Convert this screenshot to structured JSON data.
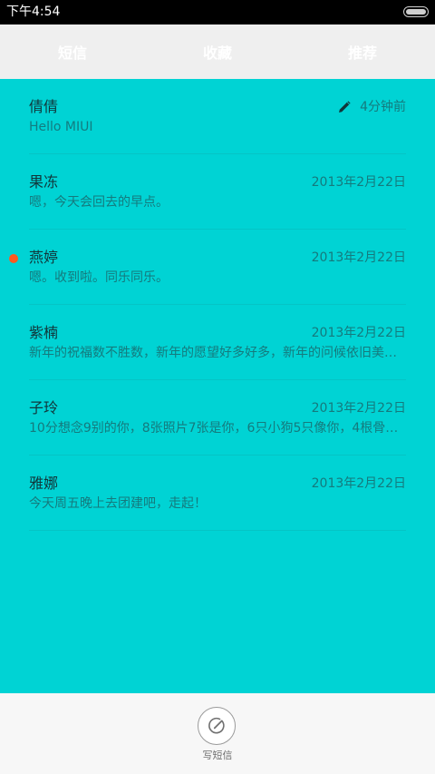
{
  "status_bar": {
    "time": "下午4:54"
  },
  "tabs": [
    {
      "label": "短信"
    },
    {
      "label": "收藏"
    },
    {
      "label": "推荐"
    }
  ],
  "messages": [
    {
      "name": "倩倩",
      "preview": "Hello MIUI",
      "time": "4分钟前",
      "draft": true,
      "unread": false
    },
    {
      "name": "果冻",
      "preview": "嗯，今天会回去的早点。",
      "time": "2013年2月22日",
      "draft": false,
      "unread": false
    },
    {
      "name": "燕婷",
      "preview": "嗯。收到啦。同乐同乐。",
      "time": "2013年2月22日",
      "draft": false,
      "unread": true
    },
    {
      "name": "紫楠",
      "preview": "新年的祝福数不胜数，新年的愿望好多好多，新年的问候依旧美好…",
      "time": "2013年2月22日",
      "draft": false,
      "unread": false
    },
    {
      "name": "子玲",
      "preview": "10分想念9别的你，8张照片7张是你，6只小狗5只像你，4根骨头…",
      "time": "2013年2月22日",
      "draft": false,
      "unread": false
    },
    {
      "name": "雅娜",
      "preview": "今天周五晚上去团建吧，走起！",
      "time": "2013年2月22日",
      "draft": false,
      "unread": false
    }
  ],
  "compose": {
    "label": "写短信",
    "icon": "compose-icon"
  },
  "colors": {
    "content_background": "#00d3d4",
    "tab_bar_background": "#efefef",
    "unread_dot": "#ff5a1f",
    "status_bar": "#000000"
  }
}
